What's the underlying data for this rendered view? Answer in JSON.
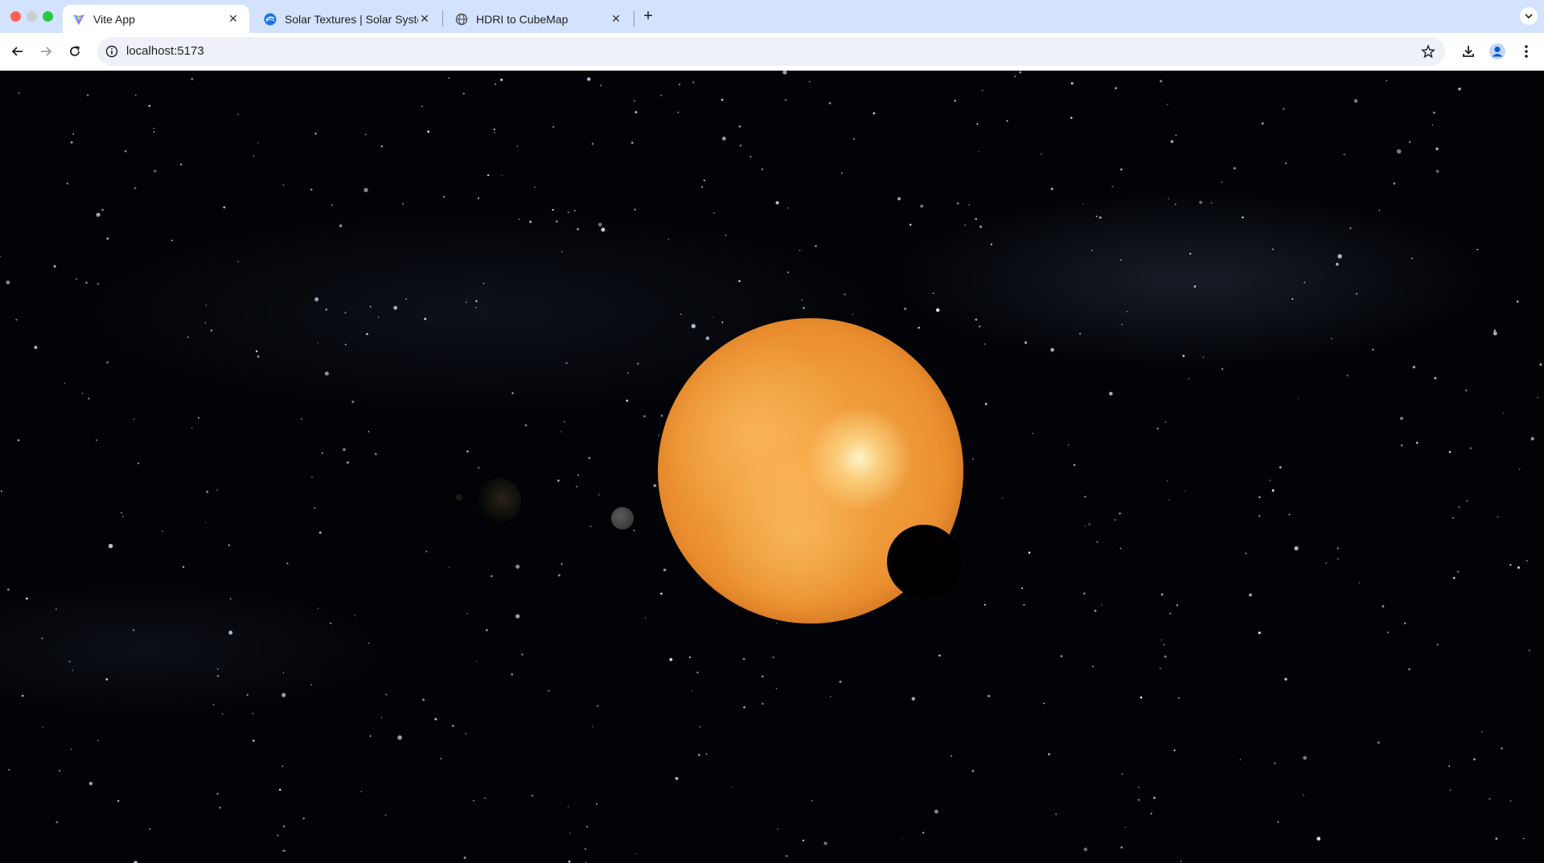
{
  "browser": {
    "tabs": [
      {
        "title": "Vite App",
        "icon": "vite-logo-icon",
        "active": true
      },
      {
        "title": "Solar Textures | Solar System Scope",
        "icon": "solar-system-scope-icon",
        "active": false
      },
      {
        "title": "HDRI to CubeMap",
        "icon": "globe-icon",
        "active": false
      }
    ],
    "address": "localhost:5173"
  },
  "scene": {
    "background": "#020306",
    "sun_color": "#ee9a39"
  }
}
